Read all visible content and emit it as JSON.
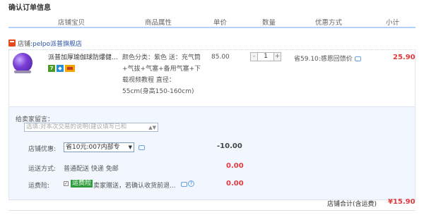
{
  "page": {
    "title": "确认订单信息"
  },
  "columns": [
    "店铺宝贝",
    "商品属性",
    "单价",
    "数量",
    "优惠方式",
    "小计"
  ],
  "shop": {
    "prefix": "店铺:",
    "name": "pelpo派普旗舰店"
  },
  "item": {
    "title": "派普加厚瑜伽球防爆健...",
    "attributes": "颜色分类：紫色 送：充气筒+气拔+气塞+备用气塞+下载视频教程 直径：55cm(身高150-160cm)",
    "price": "85.00",
    "quantity": "1",
    "qty_minus": "-",
    "qty_plus": "+",
    "discount": "省59.10:感恩回馈价",
    "subtotal": "25.90"
  },
  "message": {
    "label": "给卖家留言：",
    "placeholder": "选填:对本次交易的说明(建议填写已和"
  },
  "shop_discount": {
    "label": "店铺优惠:",
    "selected": "省10元:007内部专",
    "amount": "-10.00"
  },
  "shipping": {
    "label": "运送方式:",
    "value": "普通配送 快递 免邮",
    "amount": "0.00"
  },
  "insurance": {
    "label": "运费险:",
    "tag": "运费险",
    "text": "卖家赠送，若确认收货前退...",
    "amount": "0.00"
  },
  "total": {
    "label": "店铺合计(含运费)",
    "value": "¥15.90"
  },
  "colors": {
    "accent_red": "#e4393c",
    "header_line": "#b2d1ff",
    "panel_bg": "#f2f7ff"
  }
}
